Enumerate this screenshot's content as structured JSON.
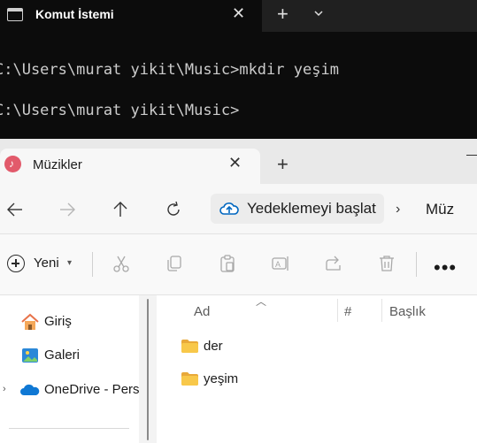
{
  "terminal": {
    "tab_title": "Komut İstemi",
    "lines": [
      "C:\\Users\\murat yikit\\Music>mkdir yeşim",
      "C:\\Users\\murat yikit\\Music>"
    ],
    "colors": {
      "background": "#0c0c0c",
      "text": "#cccccc",
      "tabbar": "#202020"
    }
  },
  "explorer": {
    "tab_title": "Müzikler",
    "address": {
      "backup_label": "Yedeklemeyi başlat",
      "breadcrumb": "Müz"
    },
    "command_bar": {
      "new_label": "Yeni",
      "more_label": "•••"
    },
    "nav_pane": {
      "items": [
        {
          "label": "Giriş",
          "icon": "home-icon"
        },
        {
          "label": "Galeri",
          "icon": "gallery-icon"
        },
        {
          "label": "OneDrive - Perso",
          "icon": "onedrive-icon"
        }
      ]
    },
    "columns": [
      "Ad",
      "#",
      "Başlık"
    ],
    "files": [
      {
        "name": "der",
        "icon": "folder-icon"
      },
      {
        "name": "yeşim",
        "icon": "folder-icon"
      }
    ],
    "colors": {
      "accent": "#0067c0",
      "folder": "#f8c84a"
    }
  }
}
